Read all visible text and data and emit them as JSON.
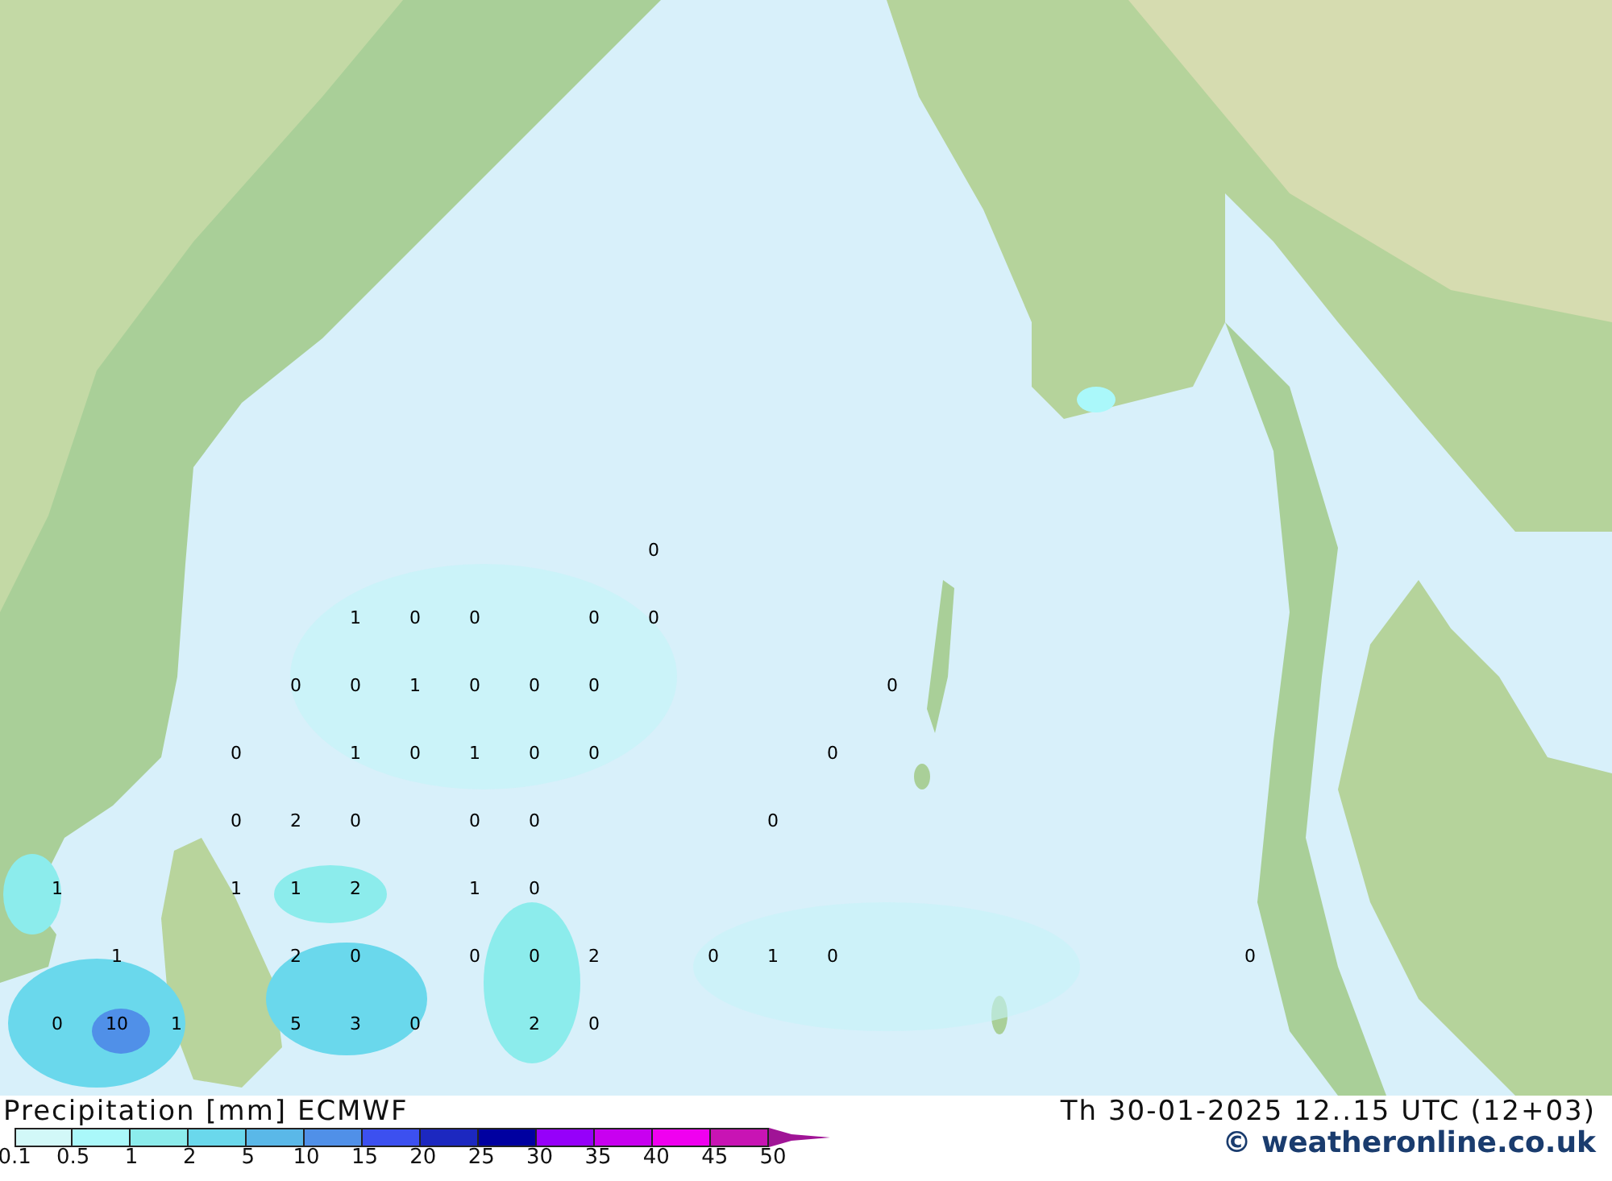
{
  "map": {
    "value_rows": [
      [
        null,
        null,
        null,
        null,
        null,
        null,
        null,
        null,
        null,
        null,
        "0",
        null,
        null,
        null,
        null,
        null,
        null,
        null,
        null,
        null,
        null
      ],
      [
        null,
        null,
        null,
        null,
        null,
        "1",
        "0",
        "0",
        null,
        "0",
        "0",
        null,
        null,
        null,
        null,
        null,
        null,
        null,
        null,
        null,
        null
      ],
      [
        null,
        null,
        null,
        null,
        "0",
        "0",
        "1",
        "0",
        "0",
        "0",
        null,
        null,
        null,
        null,
        "0",
        null,
        null,
        null,
        null,
        null,
        null
      ],
      [
        null,
        null,
        null,
        "0",
        null,
        "1",
        "0",
        "1",
        "0",
        "0",
        null,
        null,
        null,
        "0",
        null,
        null,
        null,
        null,
        null,
        null,
        null
      ],
      [
        null,
        null,
        null,
        "0",
        "2",
        "0",
        null,
        "0",
        "0",
        null,
        null,
        null,
        "0",
        null,
        null,
        null,
        null,
        null,
        null,
        null,
        null
      ],
      [
        "1",
        null,
        null,
        "1",
        "1",
        "2",
        null,
        "1",
        "0",
        null,
        null,
        null,
        null,
        null,
        null,
        null,
        null,
        null,
        null,
        null,
        null
      ],
      [
        null,
        "1",
        null,
        null,
        "2",
        "0",
        null,
        "0",
        "0",
        "2",
        null,
        "0",
        "1",
        "0",
        null,
        null,
        null,
        null,
        null,
        null,
        "0"
      ],
      [
        "0",
        "10",
        "1",
        null,
        "5",
        "3",
        "0",
        null,
        "2",
        "0",
        null,
        null,
        null,
        null,
        null,
        null,
        null,
        null,
        null,
        null,
        null
      ]
    ]
  },
  "title": "Precipitation [mm] ECMWF",
  "valid_time": "Th 30-01-2025 12..15 UTC (12+03)",
  "legend": {
    "bands": [
      {
        "color": "#d2f8f8"
      },
      {
        "color": "#aaf8fa"
      },
      {
        "color": "#8cecec"
      },
      {
        "color": "#6ad8ec"
      },
      {
        "color": "#5ab8e8"
      },
      {
        "color": "#5090e8"
      },
      {
        "color": "#3c50f0"
      },
      {
        "color": "#1c28c0"
      },
      {
        "color": "#0000a0"
      },
      {
        "color": "#9600fa"
      },
      {
        "color": "#c800f0"
      },
      {
        "color": "#f000f0"
      },
      {
        "color": "#c814b4"
      }
    ],
    "labels": [
      "0.1",
      "0.5",
      "1",
      "2",
      "5",
      "10",
      "15",
      "20",
      "25",
      "30",
      "35",
      "40",
      "45",
      "50"
    ]
  },
  "credit": "© weatheronline.co.uk"
}
